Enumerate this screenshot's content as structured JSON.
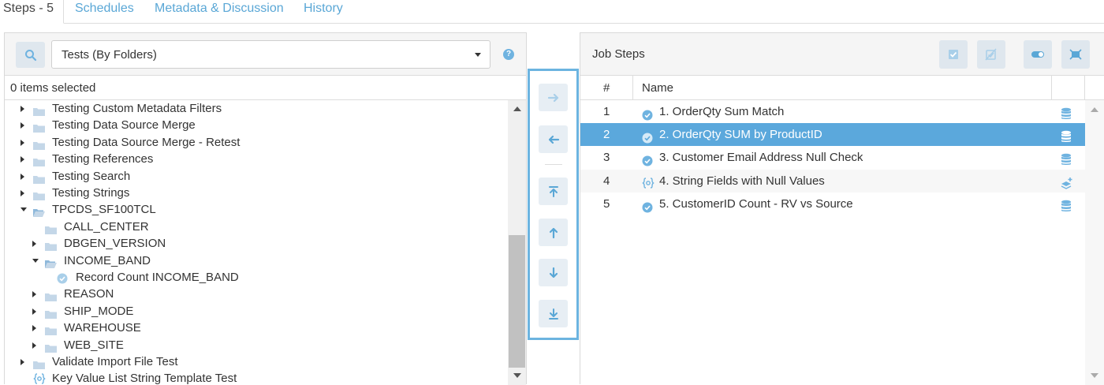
{
  "tabs": {
    "steps": "Steps - 5",
    "schedules": "Schedules",
    "metadata": "Metadata & Discussion",
    "history": "History"
  },
  "left": {
    "select_value": "Tests (By Folders)",
    "selected_count": "0 items selected",
    "tree": [
      {
        "label": "Testing Custom Metadata Filters",
        "level": 0,
        "type": "folder",
        "expanded": false
      },
      {
        "label": "Testing Data Source Merge",
        "level": 0,
        "type": "folder",
        "expanded": false
      },
      {
        "label": "Testing Data Source Merge - Retest",
        "level": 0,
        "type": "folder",
        "expanded": false
      },
      {
        "label": "Testing References",
        "level": 0,
        "type": "folder",
        "expanded": false
      },
      {
        "label": "Testing Search",
        "level": 0,
        "type": "folder",
        "expanded": false
      },
      {
        "label": "Testing Strings",
        "level": 0,
        "type": "folder",
        "expanded": false
      },
      {
        "label": "TPCDS_SF100TCL",
        "level": 0,
        "type": "folder",
        "expanded": true
      },
      {
        "label": "CALL_CENTER",
        "level": 1,
        "type": "folder",
        "expanded": null
      },
      {
        "label": "DBGEN_VERSION",
        "level": 1,
        "type": "folder",
        "expanded": false
      },
      {
        "label": "INCOME_BAND",
        "level": 1,
        "type": "folder",
        "expanded": true
      },
      {
        "label": "Record Count INCOME_BAND",
        "level": 2,
        "type": "test",
        "expanded": null
      },
      {
        "label": "REASON",
        "level": 1,
        "type": "folder",
        "expanded": false
      },
      {
        "label": "SHIP_MODE",
        "level": 1,
        "type": "folder",
        "expanded": false
      },
      {
        "label": "WAREHOUSE",
        "level": 1,
        "type": "folder",
        "expanded": false
      },
      {
        "label": "WEB_SITE",
        "level": 1,
        "type": "folder",
        "expanded": false
      },
      {
        "label": "Validate Import File Test",
        "level": 0,
        "type": "folder",
        "expanded": false
      },
      {
        "label": "Key Value List String Template Test",
        "level": 0,
        "type": "template",
        "expanded": null
      }
    ]
  },
  "right": {
    "title": "Job Steps",
    "col_num": "#",
    "col_name": "Name",
    "steps": [
      {
        "num": "1",
        "name": "1. OrderQty Sum Match",
        "icon": "check-icon",
        "source": "database-icon",
        "selected": false
      },
      {
        "num": "2",
        "name": "2. OrderQty SUM by ProductID",
        "icon": "check-icon",
        "source": "database-icon",
        "selected": true
      },
      {
        "num": "3",
        "name": "3. Customer Email Address Null Check",
        "icon": "check-icon",
        "source": "database-icon",
        "selected": false
      },
      {
        "num": "4",
        "name": "4. String Fields with Null Values",
        "icon": "template-icon",
        "source": "layers-plus-icon",
        "selected": false
      },
      {
        "num": "5",
        "name": "5. CustomerID Count - RV vs Source",
        "icon": "check-icon",
        "source": "database-icon",
        "selected": false
      }
    ]
  },
  "colors": {
    "accent": "#5aa7d6",
    "selected_row": "#5ba8dc",
    "folder": "#c4d7e8",
    "icon_blue": "#6fb3e0"
  }
}
